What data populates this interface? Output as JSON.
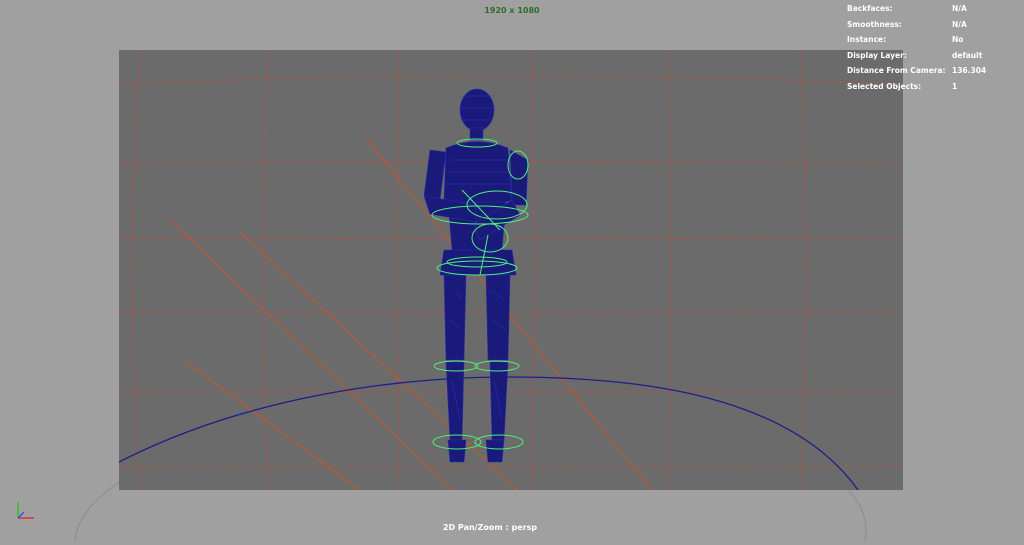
{
  "viewport": {
    "resolution_label": "1920 x 1080",
    "camera_label": "2D Pan/Zoom : persp"
  },
  "hud": {
    "rows": [
      {
        "key": "Backfaces:",
        "value": "N/A"
      },
      {
        "key": "Smoothness:",
        "value": "N/A"
      },
      {
        "key": "Instance:",
        "value": "No"
      },
      {
        "key": "Display Layer:",
        "value": "default"
      },
      {
        "key": "Distance From Camera:",
        "value": "136.304"
      },
      {
        "key": "Selected Objects:",
        "value": "1"
      }
    ]
  },
  "colors": {
    "viewport_bg": "#a0a0a0",
    "gate_bg": "#6b6b6b",
    "grid_line": "#c94a3a",
    "wireframe": "#1a1a7a",
    "controls": "#4ef07a",
    "ground_circle": "#1e1e8a"
  },
  "icons": {
    "axis": "axis-gizmo-icon"
  }
}
